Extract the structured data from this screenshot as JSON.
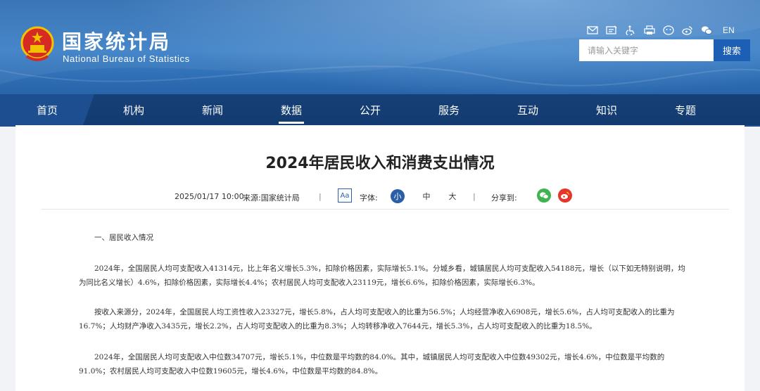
{
  "site": {
    "name_cn": "国家统计局",
    "name_en": "National Bureau of Statistics"
  },
  "tools": {
    "icons": [
      "mail-icon",
      "message-icon",
      "accessibility-icon",
      "print-icon",
      "mobile-icon",
      "weibo-icon",
      "wechat-icon"
    ],
    "lang": "EN"
  },
  "search": {
    "placeholder": "请输入关键字",
    "button": "搜索"
  },
  "nav": [
    "首页",
    "机构",
    "新闻",
    "数据",
    "公开",
    "服务",
    "互动",
    "知识",
    "专题"
  ],
  "nav_active": "数据",
  "article": {
    "title": "2024年居民收入和消费支出情况",
    "datetime": "2025/01/17 10:00",
    "source": "来源:国家统计局",
    "font_label": "字体:",
    "font_icon": "Aa",
    "font_sizes": [
      "小",
      "中",
      "大"
    ],
    "font_selected": "小",
    "share_label": "分享到:",
    "section1": "一、居民收入情况",
    "p1": "2024年，全国居民人均可支配收入41314元，比上年名义增长5.3%，扣除价格因素，实际增长5.1%。分城乡看，城镇居民人均可支配收入54188元，增长（以下如无特别说明，均为同比名义增长）4.6%，扣除价格因素，实际增长4.4%；农村居民人均可支配收入23119元，增长6.6%，扣除价格因素，实际增长6.3%。",
    "p2": "按收入来源分，2024年，全国居民人均工资性收入23327元，增长5.8%，占人均可支配收入的比重为56.5%；人均经营净收入6908元，增长5.6%，占人均可支配收入的比重为16.7%；人均财产净收入3435元，增长2.2%，占人均可支配收入的比重为8.3%；人均转移净收入7644元，增长5.3%，占人均可支配收入的比重为18.5%。",
    "p3": "2024年，全国居民人均可支配收入中位数34707元，增长5.1%，中位数是平均数的84.0%。其中，城镇居民人均可支配收入中位数49302元，增长4.6%，中位数是平均数的91.0%；农村居民人均可支配收入中位数19605元，增长4.6%，中位数是平均数的84.8%。"
  },
  "colors": {
    "header_blue": "#2f6db2",
    "nav_dark": "#103466",
    "accent": "#2a5ea8",
    "wechat_green": "#3fb34f",
    "weibo_red": "#e6352d"
  }
}
